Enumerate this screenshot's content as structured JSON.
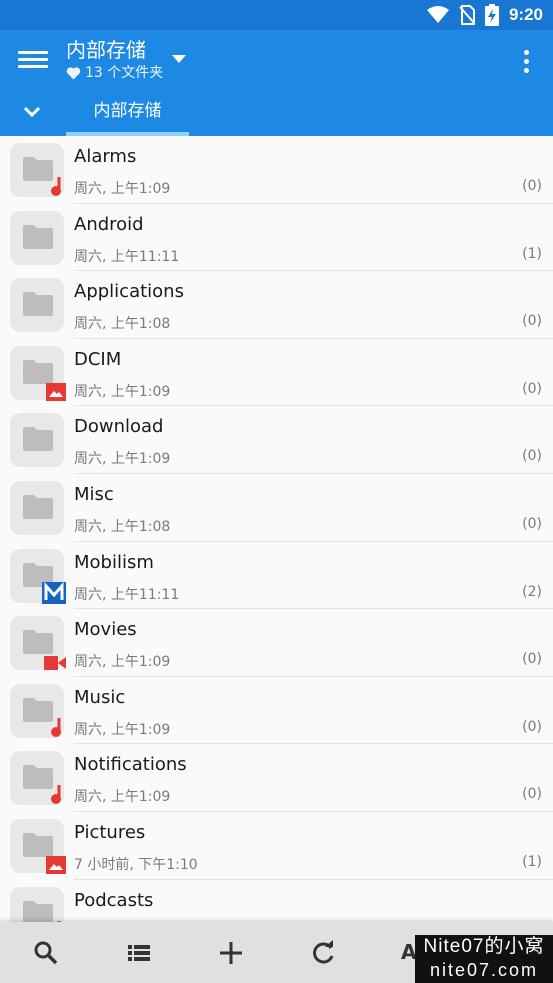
{
  "status_bar": {
    "time": "9:20",
    "icons": [
      "wifi-icon",
      "no-sim-icon",
      "battery-charging-icon"
    ]
  },
  "app_bar": {
    "title": "内部存储",
    "subtitle": "13 个文件夹",
    "subtitle_icon": "heart-icon",
    "tab_label": "内部存储",
    "accent_color": "#1e88e5",
    "status_color": "#1976d2",
    "tab_indicator_color": "#8fd3f7"
  },
  "folders": [
    {
      "name": "Alarms",
      "date": "周六, 上午1:09",
      "count": "(0)",
      "badge": "music-note-icon"
    },
    {
      "name": "Android",
      "date": "周六, 上午11:11",
      "count": "(1)",
      "badge": ""
    },
    {
      "name": "Applications",
      "date": "周六, 上午1:08",
      "count": "(0)",
      "badge": ""
    },
    {
      "name": "DCIM",
      "date": "周六, 上午1:09",
      "count": "(0)",
      "badge": "image-icon"
    },
    {
      "name": "Download",
      "date": "周六, 上午1:09",
      "count": "(0)",
      "badge": ""
    },
    {
      "name": "Misc",
      "date": "周六, 上午1:08",
      "count": "(0)",
      "badge": ""
    },
    {
      "name": "Mobilism",
      "date": "周六, 上午11:11",
      "count": "(2)",
      "badge": "mobilism-logo-icon"
    },
    {
      "name": "Movies",
      "date": "周六, 上午1:09",
      "count": "(0)",
      "badge": "video-camera-icon"
    },
    {
      "name": "Music",
      "date": "周六, 上午1:09",
      "count": "(0)",
      "badge": "music-note-icon"
    },
    {
      "name": "Notifications",
      "date": "周六, 上午1:09",
      "count": "(0)",
      "badge": "music-note-icon"
    },
    {
      "name": "Pictures",
      "date": "7 小时前, 下午1:10",
      "count": "(1)",
      "badge": "image-icon"
    },
    {
      "name": "Podcasts",
      "date": "",
      "count": "",
      "badge": "music-note-icon"
    }
  ],
  "bottom_bar": {
    "buttons": [
      "search-icon",
      "list-view-icon",
      "add-icon",
      "refresh-icon"
    ],
    "sort_label": "A"
  },
  "watermark": {
    "line1": "Nite07的小窝",
    "line2": "nite07.com"
  }
}
